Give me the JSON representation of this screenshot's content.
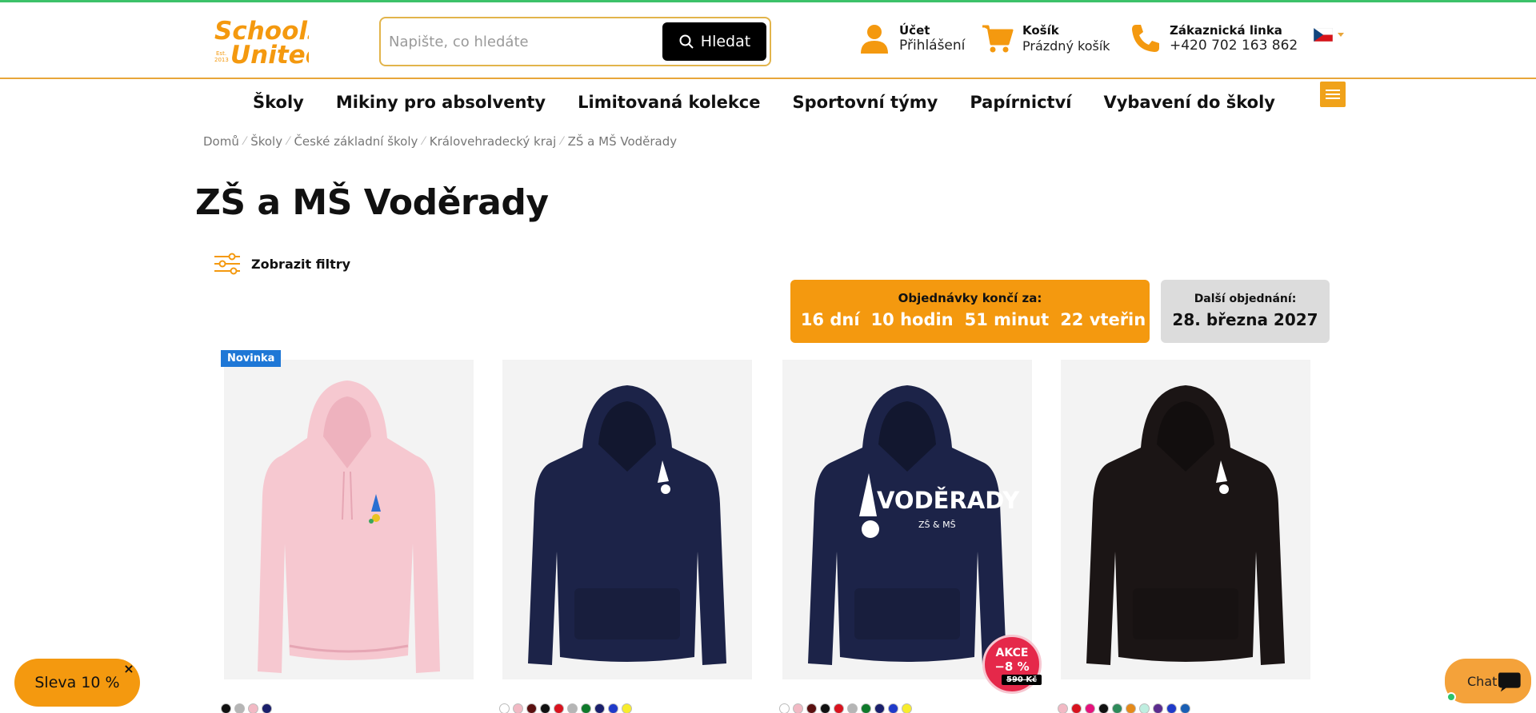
{
  "brand": {
    "line1": "Schools",
    "line2": "United",
    "est": "Est.",
    "est_year": "2013",
    "accent": "#f4990f",
    "stripe": "#3cc26a"
  },
  "search": {
    "placeholder": "Napište, co hledáte",
    "button_label": "Hledat"
  },
  "account": {
    "title": "Účet",
    "subtitle": "Přihlášení"
  },
  "cart": {
    "title": "Košík",
    "subtitle": "Prázdný košík"
  },
  "support": {
    "title": "Zákaznická linka",
    "phone": "+420 702 163 862"
  },
  "language": {
    "icon": "czech-flag-icon"
  },
  "nav": {
    "items": [
      "Školy",
      "Mikiny pro absolventy",
      "Limitovaná kolekce",
      "Sportovní týmy",
      "Papírnictví",
      "Vybavení do školy"
    ]
  },
  "breadcrumb": [
    "Domů",
    "Školy",
    "České základní školy",
    "Královehradecký kraj",
    "ZŠ a MŠ Voděrady"
  ],
  "page": {
    "title": "ZŠ a MŠ Voděrady"
  },
  "filters": {
    "label": "Zobrazit filtry"
  },
  "countdown": {
    "label": "Objednávky končí za:",
    "days": "16 dní",
    "hours": "10 hodin",
    "minutes": "51 minut",
    "seconds": "22 vteřin"
  },
  "next_order": {
    "label": "Další objednání:",
    "date": "28. března 2027"
  },
  "products": [
    {
      "badge": "Novinka",
      "color": "#f6c8d0",
      "print": "small-logo",
      "swatches": [
        "#111111",
        "#b5b5b5",
        "#f2b9c4",
        "#1a1f6b"
      ]
    },
    {
      "color": "#1c2348",
      "print": "small-logo",
      "swatches": [
        "#ffffff",
        "#f2b9c4",
        "#5a1010",
        "#111111",
        "#d8121e",
        "#b5b5b5",
        "#0f7a2b",
        "#1a1f6b",
        "#1f3ac9",
        "#f7ec2c"
      ]
    },
    {
      "color": "#1c2348",
      "print": "large-logo",
      "print_text": "VODĚRADY",
      "print_sub": "ZŠ & MŠ",
      "sale_label": "AKCE",
      "sale_percent": "−8 %",
      "old_price": "590 Kč",
      "swatches": [
        "#ffffff",
        "#f2b9c4",
        "#5a1010",
        "#111111",
        "#d8121e",
        "#b5b5b5",
        "#0f7a2b",
        "#1a1f6b",
        "#1f3ac9",
        "#f7ec2c"
      ]
    },
    {
      "color": "#1b1515",
      "print": "small-logo",
      "swatches": [
        "#f2b9c4",
        "#d8121e",
        "#e5127c",
        "#111111",
        "#2e8a5a",
        "#e58a1a",
        "#bfeee0",
        "#5b2c8e",
        "#1f3ac9",
        "#1a5fb4"
      ]
    }
  ],
  "discount_pill": {
    "label": "Sleva 10 %",
    "close": "×"
  },
  "chat": {
    "label": "Chat"
  }
}
